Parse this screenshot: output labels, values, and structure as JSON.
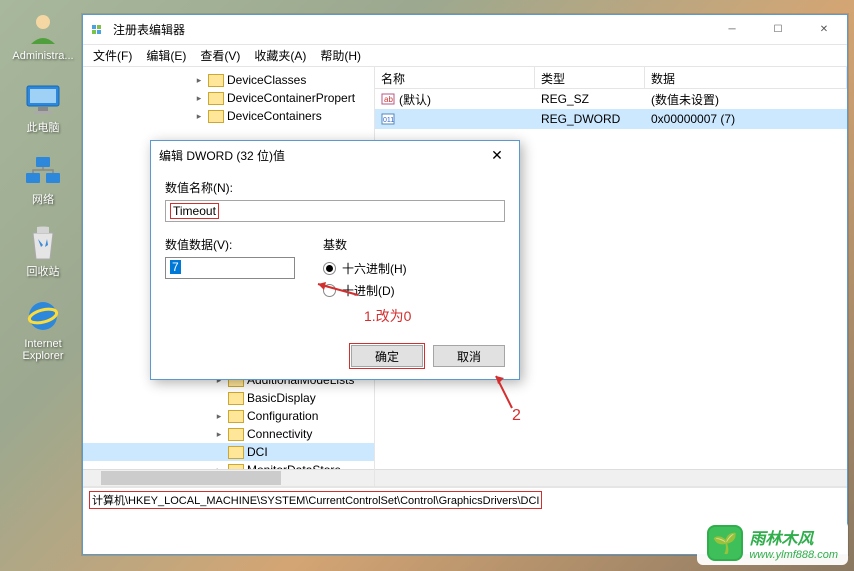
{
  "desktop": {
    "icons": [
      {
        "label": "Administra..."
      },
      {
        "label": "此电脑"
      },
      {
        "label": "网络"
      },
      {
        "label": "回收站"
      },
      {
        "label": "Internet Explorer"
      }
    ]
  },
  "regedit": {
    "title": "注册表编辑器",
    "menu": [
      "文件(F)",
      "编辑(E)",
      "查看(V)",
      "收藏夹(A)",
      "帮助(H)"
    ],
    "tree": {
      "items_top": [
        {
          "label": "DeviceClasses",
          "indent": 110
        },
        {
          "label": "DeviceContainerPropert",
          "indent": 110
        },
        {
          "label": "DeviceContainers",
          "indent": 110
        }
      ],
      "items_bottom": [
        {
          "label": "AdditionalModeLists",
          "indent": 130
        },
        {
          "label": "BasicDisplay",
          "indent": 130
        },
        {
          "label": "Configuration",
          "indent": 130
        },
        {
          "label": "Connectivity",
          "indent": 130
        },
        {
          "label": "DCI",
          "indent": 130,
          "selected": true
        },
        {
          "label": "MonitorDataStore",
          "indent": 130
        }
      ]
    },
    "list": {
      "headers": {
        "name": "名称",
        "type": "类型",
        "data": "数据"
      },
      "rows": [
        {
          "name": "(默认)",
          "type": "REG_SZ",
          "data": "(数值未设置)",
          "icon": "ab",
          "selected": false
        },
        {
          "name": "",
          "type": "REG_DWORD",
          "data": "0x00000007 (7)",
          "icon": "011",
          "selected": true
        }
      ]
    },
    "status": "计算机\\HKEY_LOCAL_MACHINE\\SYSTEM\\CurrentControlSet\\Control\\GraphicsDrivers\\DCI"
  },
  "dialog": {
    "title": "编辑 DWORD (32 位)值",
    "name_label": "数值名称(N):",
    "name_value": "Timeout",
    "value_label": "数值数据(V):",
    "value_value": "7",
    "radix_label": "基数",
    "radix_hex": "十六进制(H)",
    "radix_dec": "十进制(D)",
    "ok": "确定",
    "cancel": "取消"
  },
  "annotations": {
    "note1": "1.改为0",
    "note2": "2"
  },
  "watermark": {
    "title": "雨林木风",
    "url": "www.ylmf888.com"
  }
}
